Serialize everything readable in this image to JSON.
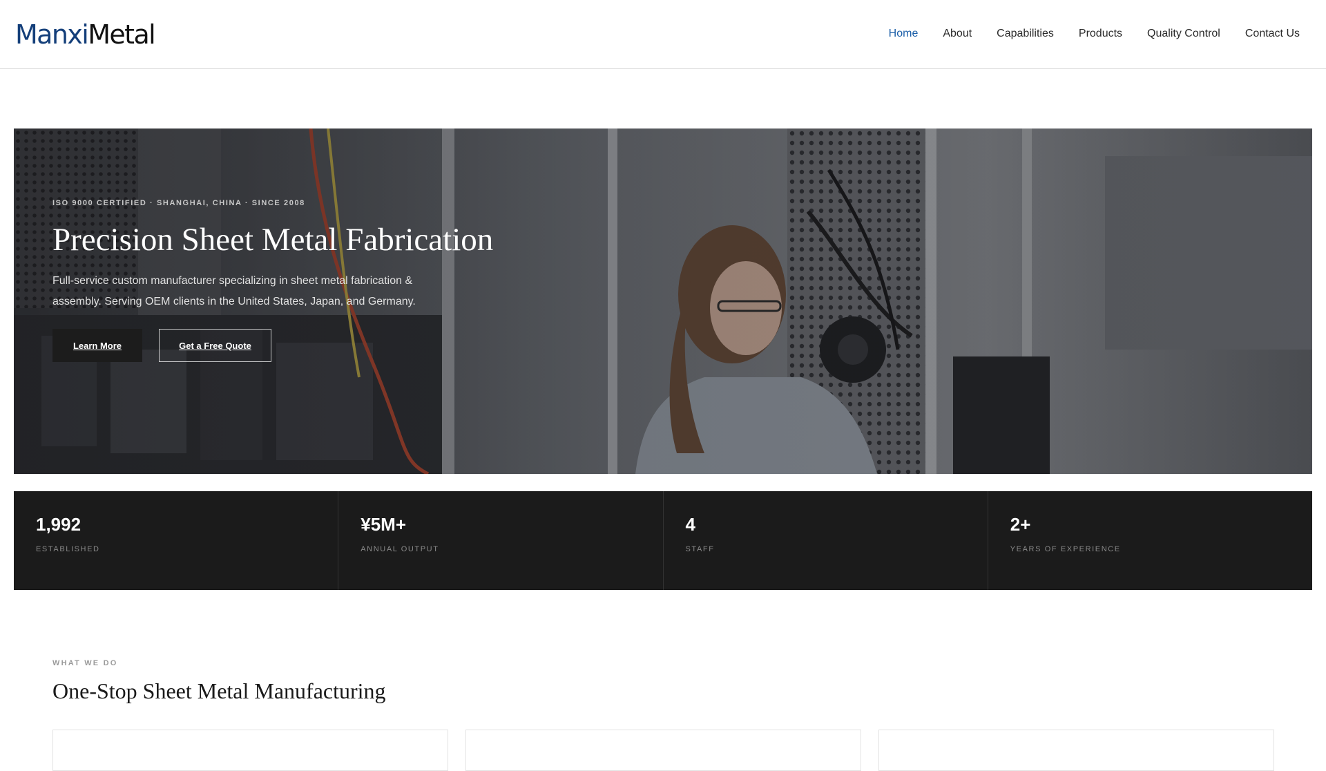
{
  "brand": {
    "name_part1": "Manxi",
    "name_part2": "Metal"
  },
  "nav": {
    "items": [
      {
        "label": "Home",
        "active": true
      },
      {
        "label": "About",
        "active": false
      },
      {
        "label": "Capabilities",
        "active": false
      },
      {
        "label": "Products",
        "active": false
      },
      {
        "label": "Quality Control",
        "active": false
      },
      {
        "label": "Contact Us",
        "active": false
      }
    ]
  },
  "hero": {
    "eyebrow": "ISO 9000 CERTIFIED · SHANGHAI, CHINA · SINCE 2008",
    "title": "Precision Sheet Metal Fabrication",
    "description": "Full-service custom manufacturer specializing in sheet metal fabrication & assembly. Serving OEM clients in the United States, Japan, and Germany.",
    "primary_button": "Learn More",
    "secondary_button": "Get a Free Quote"
  },
  "stats": [
    {
      "value": "1,992",
      "label": "ESTABLISHED"
    },
    {
      "value": "¥5M+",
      "label": "ANNUAL OUTPUT"
    },
    {
      "value": "4",
      "label": "STAFF"
    },
    {
      "value": "2+",
      "label": "YEARS OF EXPERIENCE"
    }
  ],
  "services": {
    "eyebrow": "WHAT WE DO",
    "title": "One-Stop Sheet Metal Manufacturing"
  },
  "colors": {
    "brand_blue": "#143f7a",
    "nav_active": "#1a5ea8",
    "stats_background": "#1b1b1b",
    "primary_button": "#1c1c1c"
  }
}
